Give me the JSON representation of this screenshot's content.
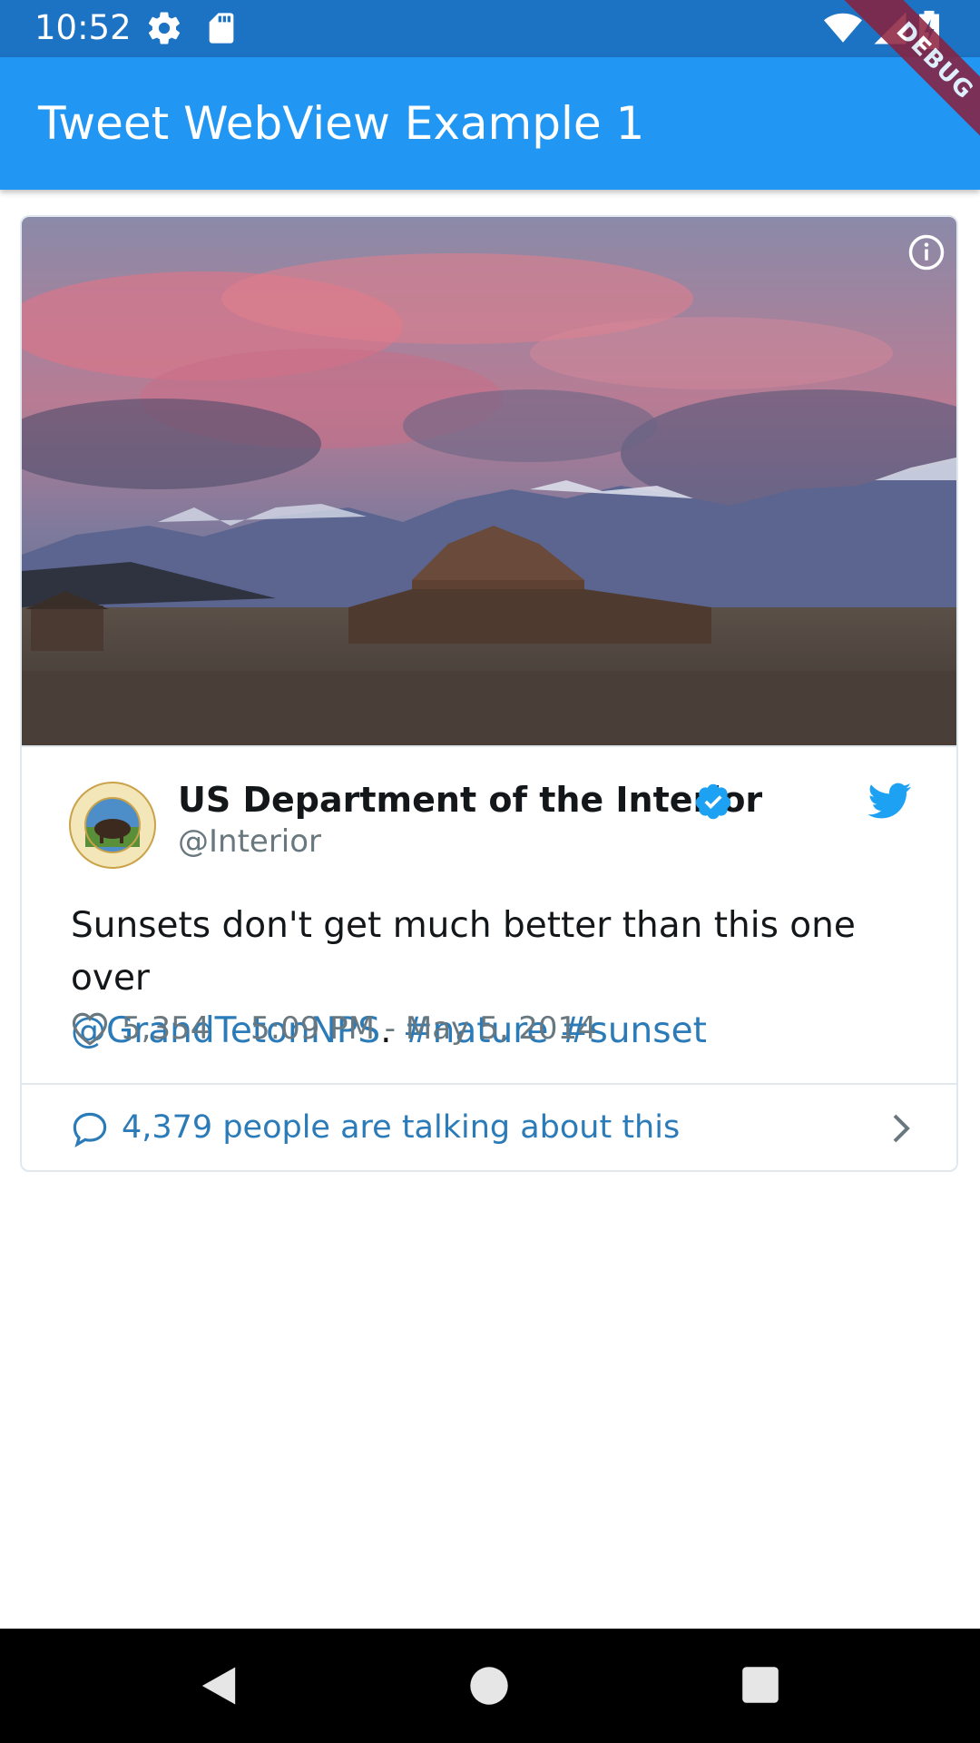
{
  "status_bar": {
    "time": "10:52",
    "icons": [
      "settings-icon",
      "sd-card-icon",
      "wifi-icon",
      "signal-icon",
      "battery-icon"
    ]
  },
  "app_bar": {
    "title": "Tweet WebView Example 1",
    "background": "#2196f3"
  },
  "debug_banner": {
    "label": "DEBUG"
  },
  "tweet": {
    "author_name": "US Department of the Interior",
    "author_handle": "@Interior",
    "verified": true,
    "text_plain": "Sunsets don't get much better than this one over",
    "mention": "@GrandTetonNPS",
    "text_period": ".",
    "hashtag_1": "#nature",
    "hashtag_2": "#sunset",
    "like_count": "5,354",
    "date": "5:09 PM - May 5, 2014",
    "talking": "4,379 people are talking about this",
    "link_color": "#2b7bb9"
  },
  "nav_bar": {
    "buttons": [
      "back-icon",
      "home-icon",
      "recents-icon"
    ]
  }
}
